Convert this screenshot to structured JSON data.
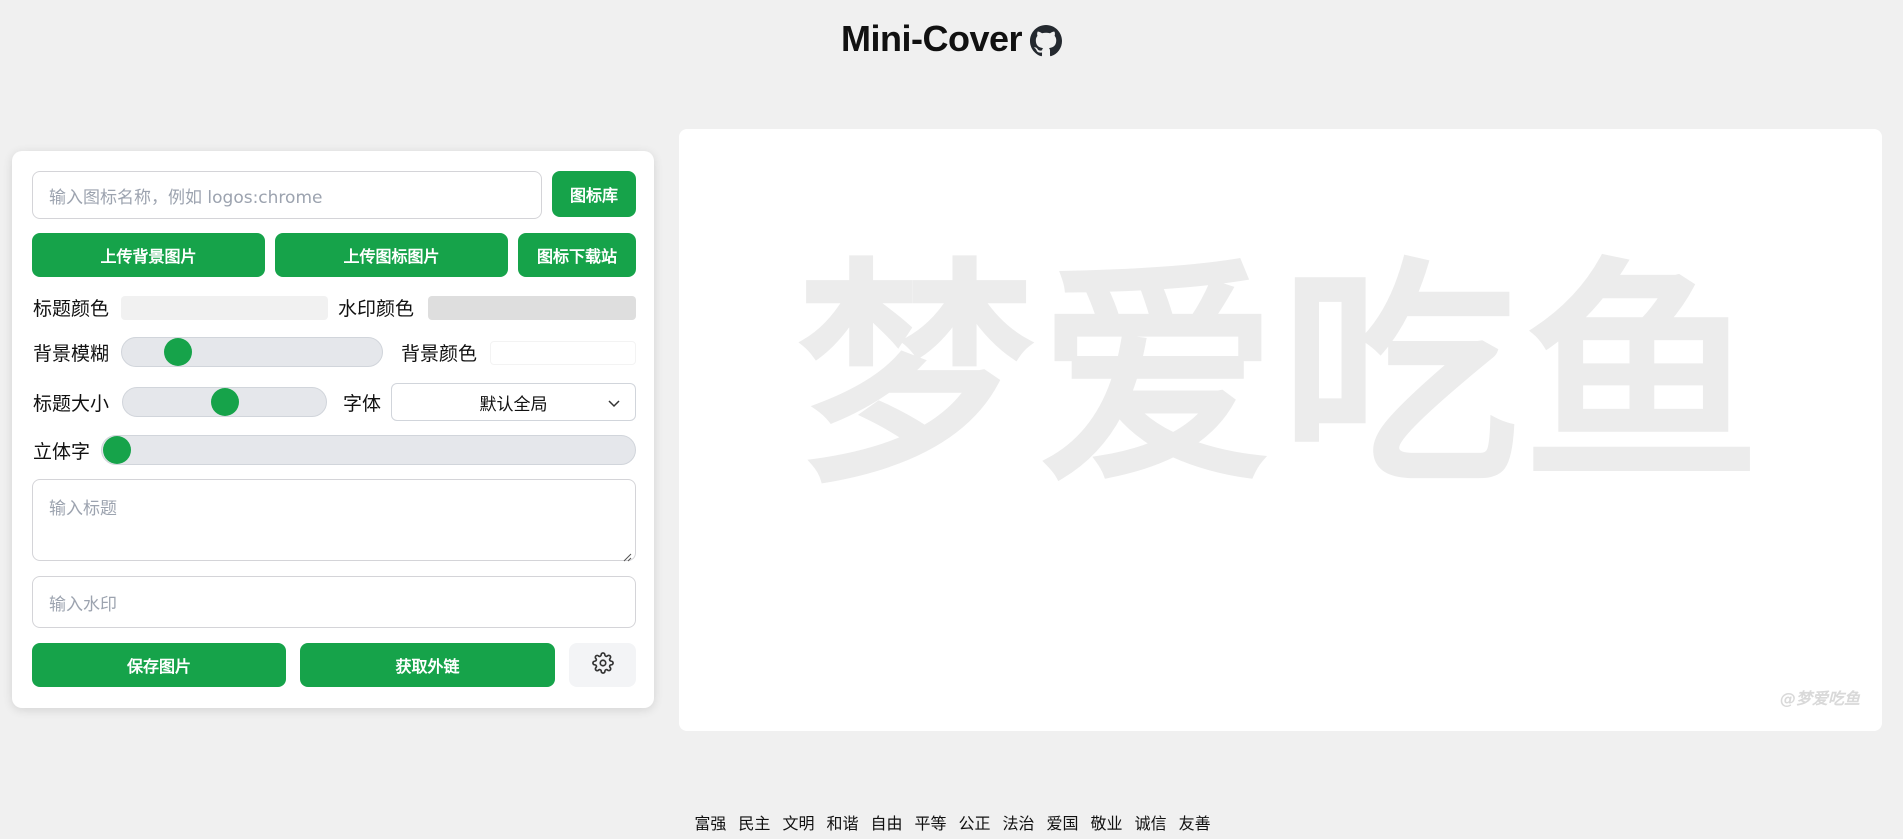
{
  "header": {
    "title": "Mini-Cover",
    "github_icon": "github-icon"
  },
  "controls": {
    "icon_search": {
      "placeholder": "输入图标名称，例如 logos:chrome",
      "value": ""
    },
    "icon_library_label": "图标库",
    "upload_background_label": "上传背景图片",
    "upload_icon_label": "上传图标图片",
    "icon_download_label": "图标下载站",
    "title_color_label": "标题颜色",
    "title_color_value": "#f1f1f1",
    "watermark_color_label": "水印颜色",
    "watermark_color_value": "#dedede",
    "background_blur_label": "背景模糊",
    "background_blur_value": 0.18,
    "background_color_label": "背景颜色",
    "background_color_value": "#ffffff",
    "title_size_label": "标题大小",
    "title_size_value": 0.5,
    "font_label": "字体",
    "font_selected": "默认全局",
    "three_d_label": "立体字",
    "three_d_value": 0,
    "title_input": {
      "placeholder": "输入标题",
      "value": ""
    },
    "watermark_input": {
      "placeholder": "输入水印",
      "value": ""
    },
    "save_label": "保存图片",
    "external_link_label": "获取外链",
    "settings_icon": "gear-icon"
  },
  "preview": {
    "title_text": "梦爱吃鱼",
    "watermark_text": "@梦爱吃鱼"
  },
  "footer": {
    "values": [
      "富强",
      "民主",
      "文明",
      "和谐",
      "自由",
      "平等",
      "公正",
      "法治",
      "爱国",
      "敬业",
      "诚信",
      "友善"
    ]
  },
  "colors": {
    "accent": "#16a34a",
    "page_background": "#f0f0f0",
    "slider_track": "#e5e7eb"
  }
}
